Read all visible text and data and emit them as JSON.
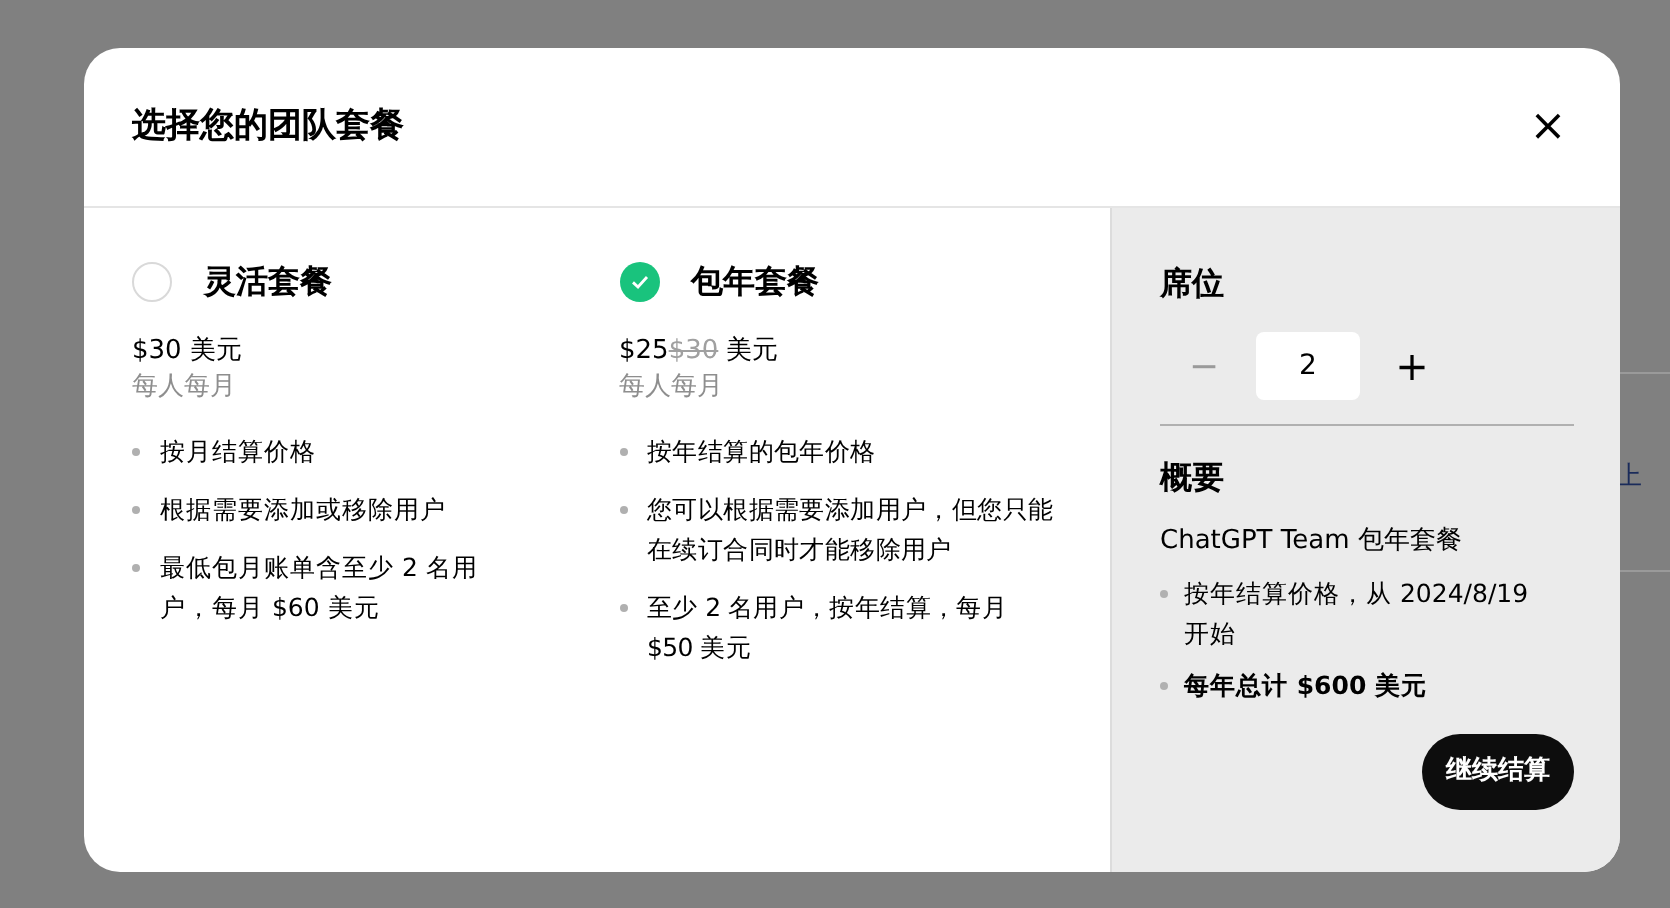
{
  "background": {
    "text": "上"
  },
  "dialog": {
    "title": "选择您的团队套餐",
    "close": "×"
  },
  "plans": [
    {
      "name": "灵活套餐",
      "selected": false,
      "price": "$30",
      "currency": "美元",
      "period": "每人每月",
      "features": [
        "按月结算价格",
        "根据需要添加或移除用户",
        "最低包月账单含至少 2 名用户，每月 $60 美元"
      ]
    },
    {
      "name": "包年套餐",
      "selected": true,
      "price": "$25",
      "old_price": "$30",
      "currency": "美元",
      "period": "每人每月",
      "features": [
        "按年结算的包年价格",
        "您可以根据需要添加用户，但您只能在续订合同时才能移除用户",
        "至少 2 名用户，按年结算，每月 $50 美元"
      ]
    }
  ],
  "seats": {
    "title": "席位",
    "minus": "−",
    "value": "2",
    "plus": "+",
    "minus_disabled": true
  },
  "summary": {
    "title": "概要",
    "plan": "ChatGPT Team 包年套餐",
    "items": [
      {
        "text": "按年结算价格，从 2024/8/19 开始",
        "bold": false
      },
      {
        "text": "每年总计 $600 美元",
        "bold": true
      }
    ]
  },
  "checkout_button": "继续结算"
}
